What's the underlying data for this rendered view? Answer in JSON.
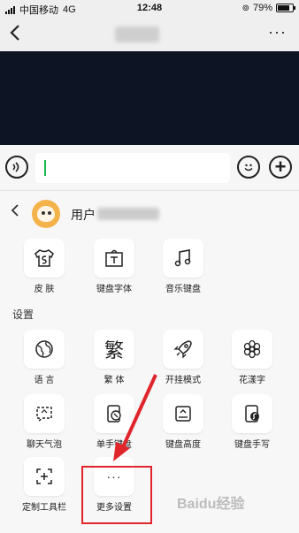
{
  "status_bar": {
    "carrier": "中国移动",
    "network": "4G",
    "time": "12:48",
    "battery_percent": "79%",
    "battery_level": 0.79
  },
  "nav": {
    "back_icon": "chevron-left-icon",
    "more_label": "···"
  },
  "input_bar": {
    "voice_icon": "voice-icon",
    "emoji_icon": "emoji-icon",
    "plus_label": "+"
  },
  "panel": {
    "user_label": "用户",
    "top_row": [
      {
        "label": "皮 肤",
        "icon": "shirt-icon"
      },
      {
        "label": "键盘字体",
        "icon": "font-icon"
      },
      {
        "label": "音乐键盘",
        "icon": "music-note-icon"
      }
    ],
    "settings_title": "设置",
    "settings": [
      {
        "label": "语 言",
        "icon": "globe-icon"
      },
      {
        "label": "繁 体",
        "icon": "traditional-char-icon",
        "glyph": "繁"
      },
      {
        "label": "开挂模式",
        "icon": "rocket-icon"
      },
      {
        "label": "花漾字",
        "icon": "flower-icon"
      },
      {
        "label": "聊天气泡",
        "icon": "chat-bubble-icon"
      },
      {
        "label": "单手键盘",
        "icon": "one-hand-keyboard-icon"
      },
      {
        "label": "键盘高度",
        "icon": "keyboard-height-icon"
      },
      {
        "label": "键盘手写",
        "icon": "handwriting-icon"
      },
      {
        "label": "定制工具栏",
        "icon": "custom-toolbar-icon"
      },
      {
        "label": "更多设置",
        "icon": "more-icon",
        "glyph": "···"
      }
    ]
  },
  "watermark": "Baidu经验"
}
